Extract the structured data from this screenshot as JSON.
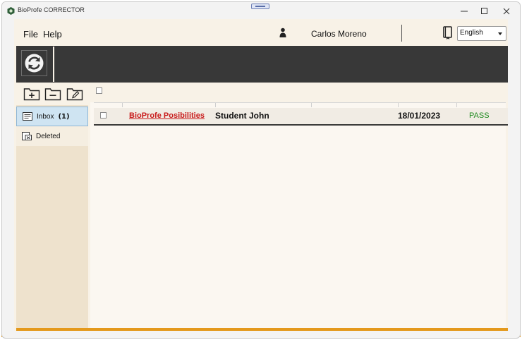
{
  "window": {
    "title": "BioProfe CORRECTOR",
    "colors": {
      "accent": "#e4991c",
      "toolbar": "#383838",
      "link": "#c81a1a",
      "pass": "#1e8a1e"
    }
  },
  "menu": {
    "file": "File",
    "help": "Help"
  },
  "user": {
    "name": "Carlos Moreno"
  },
  "language": {
    "selected": "English"
  },
  "toolbar": {
    "refresh_icon": "refresh-icon"
  },
  "sidebar": {
    "actions": [
      "add-folder-icon",
      "remove-folder-icon",
      "edit-folder-icon"
    ],
    "folders": [
      {
        "label": "Inbox",
        "count": "(1)",
        "icon": "inbox-icon",
        "selected": true
      },
      {
        "label": "Deleted",
        "count": "",
        "icon": "deleted-icon",
        "selected": false
      }
    ]
  },
  "list": {
    "rows": [
      {
        "title": "BioProfe Posibilities",
        "student": "Student John",
        "date": "18/01/2023",
        "status": "PASS"
      }
    ]
  }
}
